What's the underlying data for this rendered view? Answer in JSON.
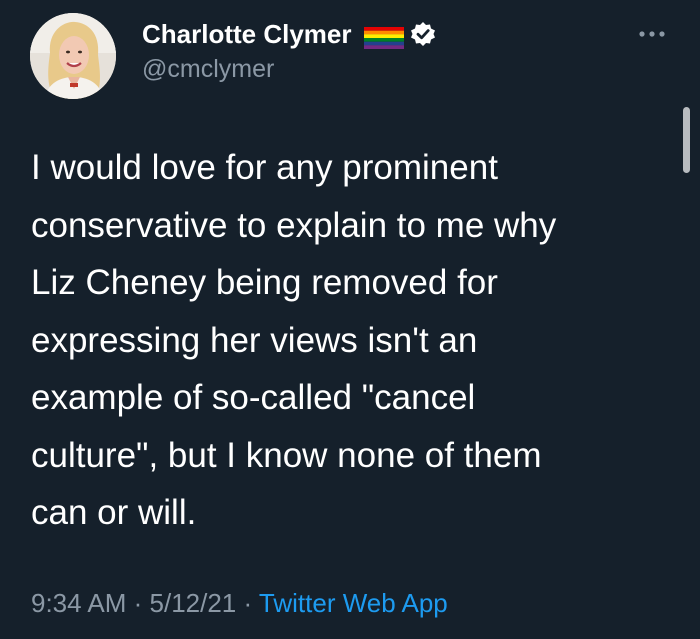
{
  "author": {
    "display_name": "Charlotte Clymer",
    "handle": "@cmclymer",
    "verified": true,
    "avatar_icon": "profile-photo",
    "flag_icon": "rainbow-flag-icon"
  },
  "tweet": {
    "lines": [
      "I would love for any prominent",
      "conservative to explain to me why",
      "Liz Cheney being removed for",
      "expressing her views isn't an",
      "example of so-called \"cancel",
      "culture\", but I know none of them",
      "can or will."
    ],
    "time": "9:34 AM",
    "separator": " · ",
    "date": "5/12/21",
    "source": "Twitter Web App"
  },
  "colors": {
    "background": "#15202b",
    "text": "#ffffff",
    "secondary": "#8b98a5",
    "link": "#1d9bf0"
  }
}
